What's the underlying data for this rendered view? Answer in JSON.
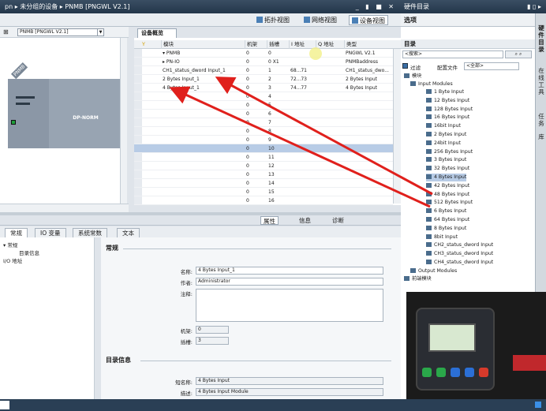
{
  "window": {
    "title": "pn ▸ 未分组的设备 ▸ PNMB [PNGWL V2.1]",
    "controls": "_ ▮ ■ ✕"
  },
  "views": {
    "topology": "拓扑视图",
    "network": "网络视图",
    "device": "设备视图"
  },
  "options_panel": {
    "title": "选项"
  },
  "canvas": {
    "device_combo": "PNMB [PNGWL V2.1]",
    "rail_label": "PNMB",
    "device_label": "DP-NORM"
  },
  "overview": {
    "tab": "设备概览",
    "columns": [
      "模块",
      "机架",
      "插槽",
      "I 地址",
      "Q 地址",
      "类型"
    ],
    "rows": [
      {
        "name": "▾ PNMB",
        "rack": "0",
        "slot": "0",
        "i": "",
        "q": "",
        "type": "PNGWL V2.1"
      },
      {
        "name": "  ▸ PN-IO",
        "rack": "0",
        "slot": "0 X1",
        "i": "",
        "q": "",
        "type": "PNMBaddress"
      },
      {
        "name": "CH1_status_dword Input_1",
        "rack": "0",
        "slot": "1",
        "i": "68...71",
        "q": "",
        "type": "CH1_status_dwo..."
      },
      {
        "name": "2 Bytes Input_1",
        "rack": "0",
        "slot": "2",
        "i": "72...73",
        "q": "",
        "type": "2 Bytes Input"
      },
      {
        "name": "4 Bytes Input_1",
        "rack": "0",
        "slot": "3",
        "i": "74...77",
        "q": "",
        "type": "4 Bytes Input"
      },
      {
        "name": "",
        "rack": "0",
        "slot": "4",
        "i": "",
        "q": "",
        "type": ""
      },
      {
        "name": "",
        "rack": "0",
        "slot": "5",
        "i": "",
        "q": "",
        "type": ""
      },
      {
        "name": "",
        "rack": "0",
        "slot": "6",
        "i": "",
        "q": "",
        "type": ""
      },
      {
        "name": "",
        "rack": "0",
        "slot": "7",
        "i": "",
        "q": "",
        "type": ""
      },
      {
        "name": "",
        "rack": "0",
        "slot": "8",
        "i": "",
        "q": "",
        "type": ""
      },
      {
        "name": "",
        "rack": "0",
        "slot": "9",
        "i": "",
        "q": "",
        "type": ""
      },
      {
        "name": "",
        "rack": "0",
        "slot": "10",
        "i": "",
        "q": "",
        "type": ""
      },
      {
        "name": "",
        "rack": "0",
        "slot": "11",
        "i": "",
        "q": "",
        "type": ""
      },
      {
        "name": "",
        "rack": "0",
        "slot": "12",
        "i": "",
        "q": "",
        "type": ""
      },
      {
        "name": "",
        "rack": "0",
        "slot": "13",
        "i": "",
        "q": "",
        "type": ""
      },
      {
        "name": "",
        "rack": "0",
        "slot": "14",
        "i": "",
        "q": "",
        "type": ""
      },
      {
        "name": "",
        "rack": "0",
        "slot": "15",
        "i": "",
        "q": "",
        "type": ""
      },
      {
        "name": "",
        "rack": "0",
        "slot": "16",
        "i": "",
        "q": "",
        "type": ""
      }
    ],
    "selected_row": 11
  },
  "inspector": {
    "tabs": {
      "properties": "属性",
      "info": "信息",
      "diagnostics": "诊断"
    },
    "subtabs": [
      "常规",
      "IO 变量",
      "系统常数",
      "文本"
    ],
    "nav": [
      "▾ 常规",
      "目录信息",
      "I/O 地址"
    ],
    "general_title": "常规",
    "name_label": "名称:",
    "name_value": "4 Bytes Input_1",
    "author_label": "作者:",
    "author_value": "Administrator",
    "comment_label": "注释:",
    "comment_value": "",
    "rack_label": "机架:",
    "rack_value": "0",
    "slot_label": "插槽:",
    "slot_value": "3",
    "catalog_title": "目录信息",
    "short_label": "短名称:",
    "short_value": "4 Bytes Input",
    "desc_label": "描述:",
    "desc_value": "4 Bytes Input Module"
  },
  "catalog": {
    "title": "硬件目录",
    "section": "目录",
    "search_placeholder": "<搜索>",
    "filter_label": "过滤",
    "profile_label": "配置文件",
    "profile_value": "<全部>",
    "tree_root": "模块",
    "input_group": "Input Modules",
    "items": [
      "1 Byte Input",
      "12 Bytes Input",
      "128 Bytes Input",
      "16 Bytes Input",
      "16bit Input",
      "2 Bytes Input",
      "24bit Input",
      "256 Bytes Input",
      "3 Bytes Input",
      "32 Bytes Input",
      "4 Bytes Input",
      "42 Bytes Input",
      "48 Bytes Input",
      "512 Bytes Input",
      "6 Bytes Input",
      "64 Bytes Input",
      "8 Bytes Input",
      "8bit Input",
      "CH2_status_dword Input",
      "CH3_status_dword Input",
      "CH4_status_dword Input"
    ],
    "selected_item": 10,
    "output_group": "Output Modules",
    "head_group": "前端模块"
  },
  "sidetabs": [
    "硬件目录",
    "在线工具",
    "任务",
    "库"
  ],
  "colors": {
    "accent": "#4a7fb5",
    "selection": "#b8cce6",
    "arrow": "#e0201c"
  }
}
